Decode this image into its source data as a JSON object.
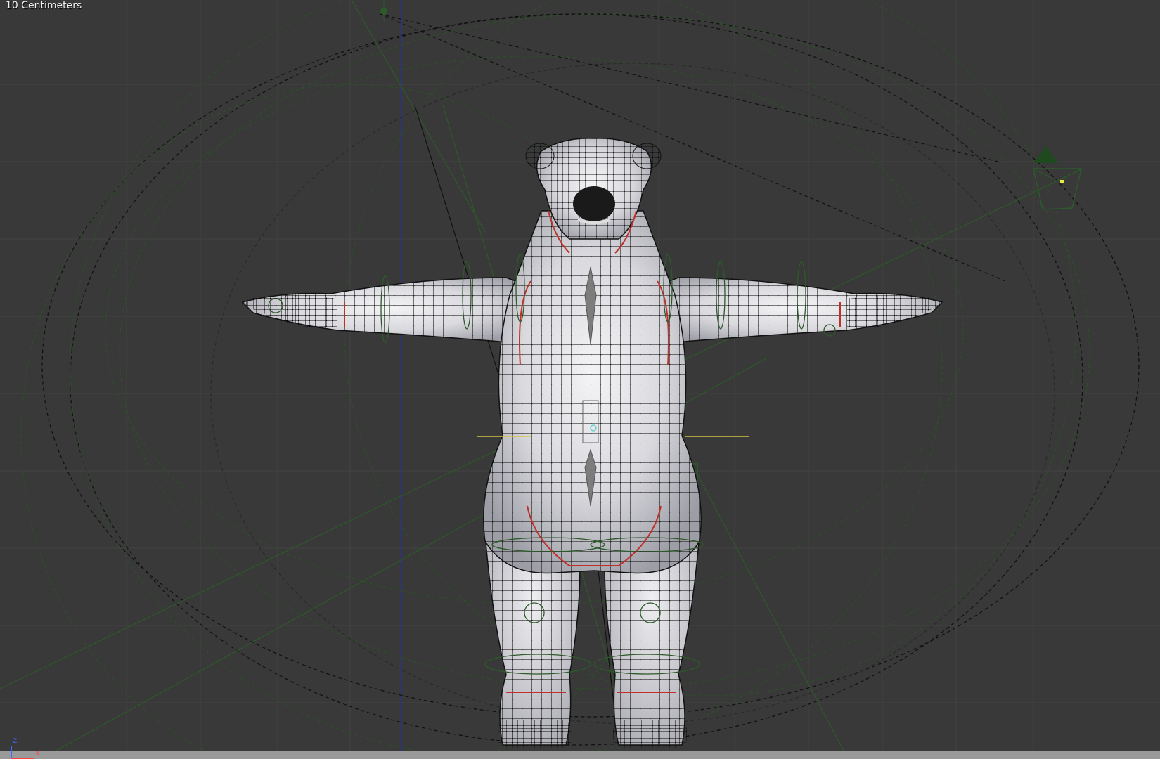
{
  "viewport": {
    "grid_scale_label": "10 Centimeters",
    "background_color": "#393939",
    "grid_color": "#424242",
    "rig_color": "#2f5a2a",
    "z_axis_color": "#2233aa"
  },
  "axis_gizmo": {
    "z_label": "Z",
    "x_label": "X",
    "z_color": "#3c6cff",
    "x_color": "#ff4040"
  },
  "scene": {
    "object": "bear mesh in T-pose, wireframe overlay",
    "icons": [
      "camera-icon",
      "lamp-icon",
      "empty-icon"
    ]
  }
}
